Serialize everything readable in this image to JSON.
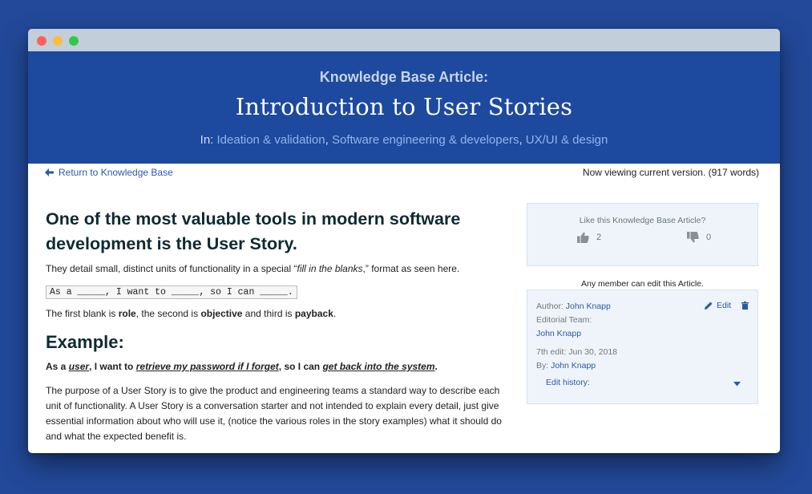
{
  "hero": {
    "kicker": "Knowledge Base Article:",
    "title": "Introduction to User Stories",
    "in_label": "In: ",
    "categories": [
      "Ideation & validation",
      "Software engineering & developers",
      "UX/UI & design"
    ]
  },
  "nav": {
    "back_label": "Return to Knowledge Base",
    "version_text": "Now viewing current version. (917 words)"
  },
  "article": {
    "heading": "One of the most valuable tools in modern software development is the User Story.",
    "lead_pre": "They detail small, distinct units of functionality in a special “",
    "lead_em": "fill in the blanks",
    "lead_post": ",” format as seen here.",
    "template": "As a _____, I want to _____, so I can _____.",
    "blanks_1": "The first blank is ",
    "role": "role",
    "blanks_2": ", the second is ",
    "objective": "objective",
    "blanks_3": " and third is ",
    "payback": "payback",
    "blanks_4": ".",
    "example_heading": "Example:",
    "ex_1": "As a ",
    "ex_user": "user",
    "ex_2": ", I want to ",
    "ex_objective": "retrieve my password if I forget",
    "ex_3": ", so I can ",
    "ex_payback": "get back into the system",
    "ex_4": ".",
    "purpose": "The purpose of a User Story is to give the product and engineering teams a standard way to describe each unit of functionality. A User Story is a conversation starter and not intended to explain every detail, just give essential information about who will use it, (notice the various roles in the story examples) what it should do and what the expected benefit is."
  },
  "sidebar": {
    "like_title": "Like this Knowledge Base Article?",
    "likes": "2",
    "dislikes": "0",
    "edit_note": "Any member can edit this Article.",
    "author_label": "Author: ",
    "author": "John Knapp",
    "edit_label": "Edit",
    "team_label": "Editorial Team:",
    "team_member": "John Knapp",
    "edit_count": "7th edit: Jun 30, 2018",
    "by_label": "By: ",
    "by": "John Knapp",
    "history_label": "Edit history:"
  },
  "colors": {
    "background": "#22499a",
    "hero": "#1d4a9e",
    "link": "#2a5aa6",
    "panel": "#eef4f9"
  },
  "icons": [
    "arrow-left-icon",
    "thumbs-up-icon",
    "thumbs-down-icon",
    "pencil-icon",
    "trash-icon",
    "caret-down-icon"
  ]
}
